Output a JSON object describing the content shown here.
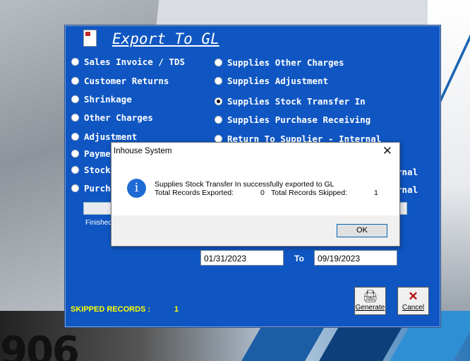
{
  "window": {
    "title": "Export To GL",
    "options_left": [
      {
        "label": "Sales Invoice / TDS",
        "selected": false
      },
      {
        "label": "Customer Returns",
        "selected": false
      },
      {
        "label": "Shrinkage",
        "selected": false
      },
      {
        "label": "Other Charges",
        "selected": false
      },
      {
        "label": "Adjustment",
        "selected": false
      },
      {
        "label": "Payme",
        "selected": false
      },
      {
        "label": "Stock",
        "selected": false
      },
      {
        "label": "Purch",
        "selected": false
      }
    ],
    "options_right": [
      {
        "label": "Supplies Other Charges",
        "selected": false
      },
      {
        "label": "Supplies Adjustment",
        "selected": false
      },
      {
        "label": "Supplies Stock Transfer In",
        "selected": true
      },
      {
        "label": "Supplies Purchase Receiving",
        "selected": false
      },
      {
        "label": "Return To Supplier - Internal",
        "selected": false
      },
      {
        "label": "rnal",
        "selected": false
      },
      {
        "label": "rnal",
        "selected": false
      }
    ],
    "finished_text": "Finished",
    "date_from": "01/31/2023",
    "to_label": "To",
    "date_to": "09/19/2023",
    "skipped_label": "SKIPPED RECORDS :",
    "skipped_value": "1",
    "generate_label": "Generate",
    "cancel_label": "Cancel"
  },
  "dialog": {
    "title": "Inhouse System",
    "message_line1": "Supplies Stock Transfer In successfully exported to GL",
    "exported_label": "Total Records Exported:",
    "exported_value": "0",
    "skipped_label": "Total Records Skipped:",
    "skipped_value": "1",
    "ok_label": "OK"
  },
  "background": {
    "partial_text": "906"
  },
  "colors": {
    "window_bg": "#0f56c2",
    "highlight_text": "#ffff00",
    "info_icon": "#1f6bd6"
  }
}
